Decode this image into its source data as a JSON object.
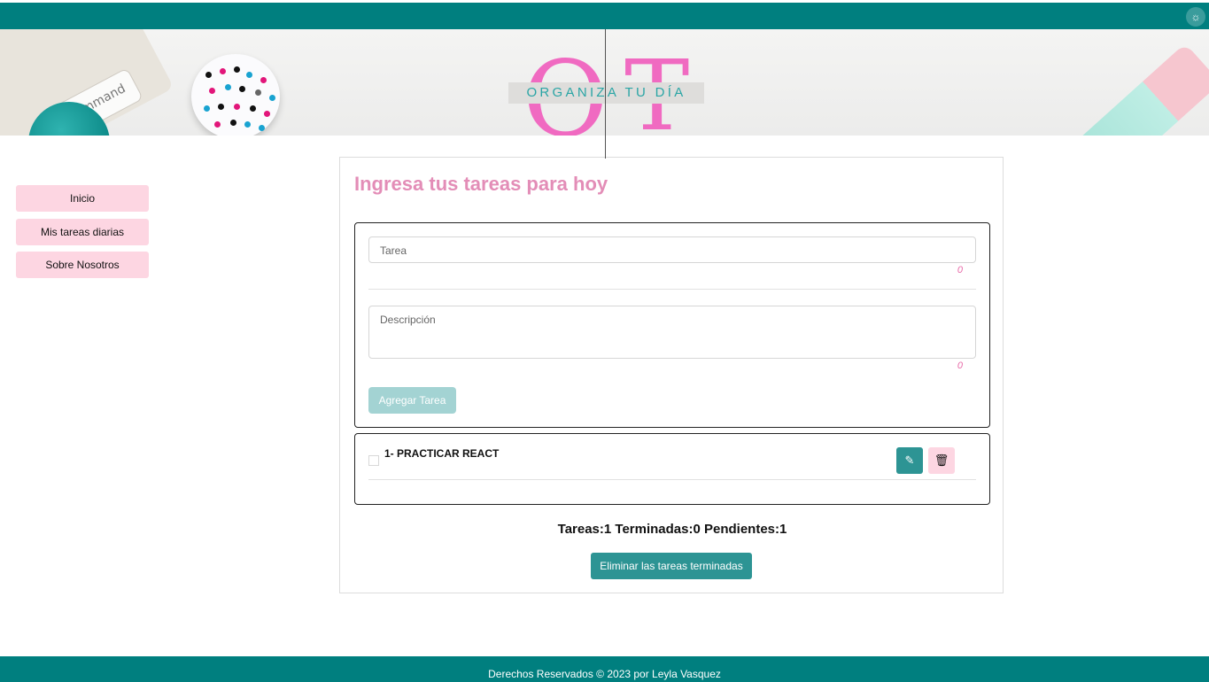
{
  "topbar": {
    "theme_icon": "sun-icon",
    "color": "#007f7f"
  },
  "banner": {
    "logo_letter_left": "O",
    "logo_letter_right": "T",
    "logo_text": "ORGANIZA TU DÍA",
    "keyboard_key": "command",
    "logo_color": "#f06ac1",
    "accent_color": "#2aa5a5"
  },
  "sidebar": {
    "items": [
      {
        "label": "Inicio"
      },
      {
        "label": "Mis tareas diarias"
      },
      {
        "label": "Sobre Nosotros"
      }
    ]
  },
  "main": {
    "title": "Ingresa tus tareas para hoy",
    "form": {
      "task_placeholder": "Tarea",
      "task_count": "0",
      "description_placeholder": "Descripción",
      "description_count": "0",
      "add_button": "Agregar Tarea"
    },
    "tasks": [
      {
        "title": "1- PRACTICAR REACT",
        "done": false,
        "edit_icon": "edit-icon",
        "delete_icon": "trash-icon"
      }
    ],
    "stats": "Tareas:1 Terminadas:0 Pendientes:1",
    "clear_button": "Eliminar las tareas terminadas"
  },
  "footer": {
    "text": "Derechos Reservados © 2023 por Leyla Vasquez"
  }
}
